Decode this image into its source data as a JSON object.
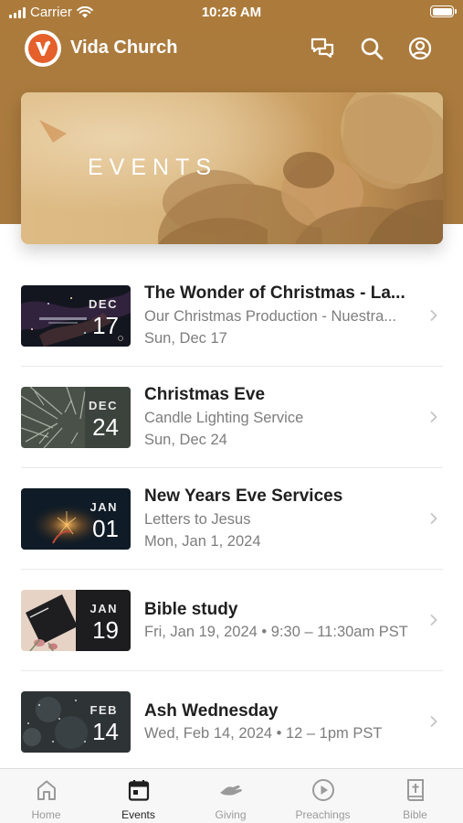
{
  "status_bar": {
    "carrier": "Carrier",
    "time": "10:26 AM"
  },
  "header": {
    "app_name": "Vida Church"
  },
  "banner": {
    "title": "EVENTS"
  },
  "events": [
    {
      "month": "DEC",
      "day": "17",
      "title": "The Wonder of Christmas -  La...",
      "subtitle": "Our Christmas Production - Nuestra...",
      "date": "Sun, Dec 17"
    },
    {
      "month": "DEC",
      "day": "24",
      "title": "Christmas Eve",
      "subtitle": "Candle Lighting Service",
      "date": "Sun, Dec 24"
    },
    {
      "month": "JAN",
      "day": "01",
      "title": "New Years Eve Services",
      "subtitle": "Letters to Jesus",
      "date": "Mon, Jan 1, 2024"
    },
    {
      "month": "JAN",
      "day": "19",
      "title": "Bible study",
      "date": "Fri, Jan 19, 2024 • 9:30 – 11:30am PST"
    },
    {
      "month": "FEB",
      "day": "14",
      "title": "Ash Wednesday",
      "date": "Wed, Feb 14, 2024 • 12 – 1pm PST"
    }
  ],
  "tabs": [
    {
      "label": "Home",
      "icon": "home-icon"
    },
    {
      "label": "Events",
      "icon": "calendar-icon"
    },
    {
      "label": "Giving",
      "icon": "giving-icon"
    },
    {
      "label": "Preachings",
      "icon": "play-circle-icon"
    },
    {
      "label": "Bible",
      "icon": "bible-icon"
    }
  ],
  "active_tab": "Events",
  "colors": {
    "header_bg": "#ac7b3c",
    "brand_orange": "#e5602a",
    "inactive_tab": "#9a9a9a"
  }
}
